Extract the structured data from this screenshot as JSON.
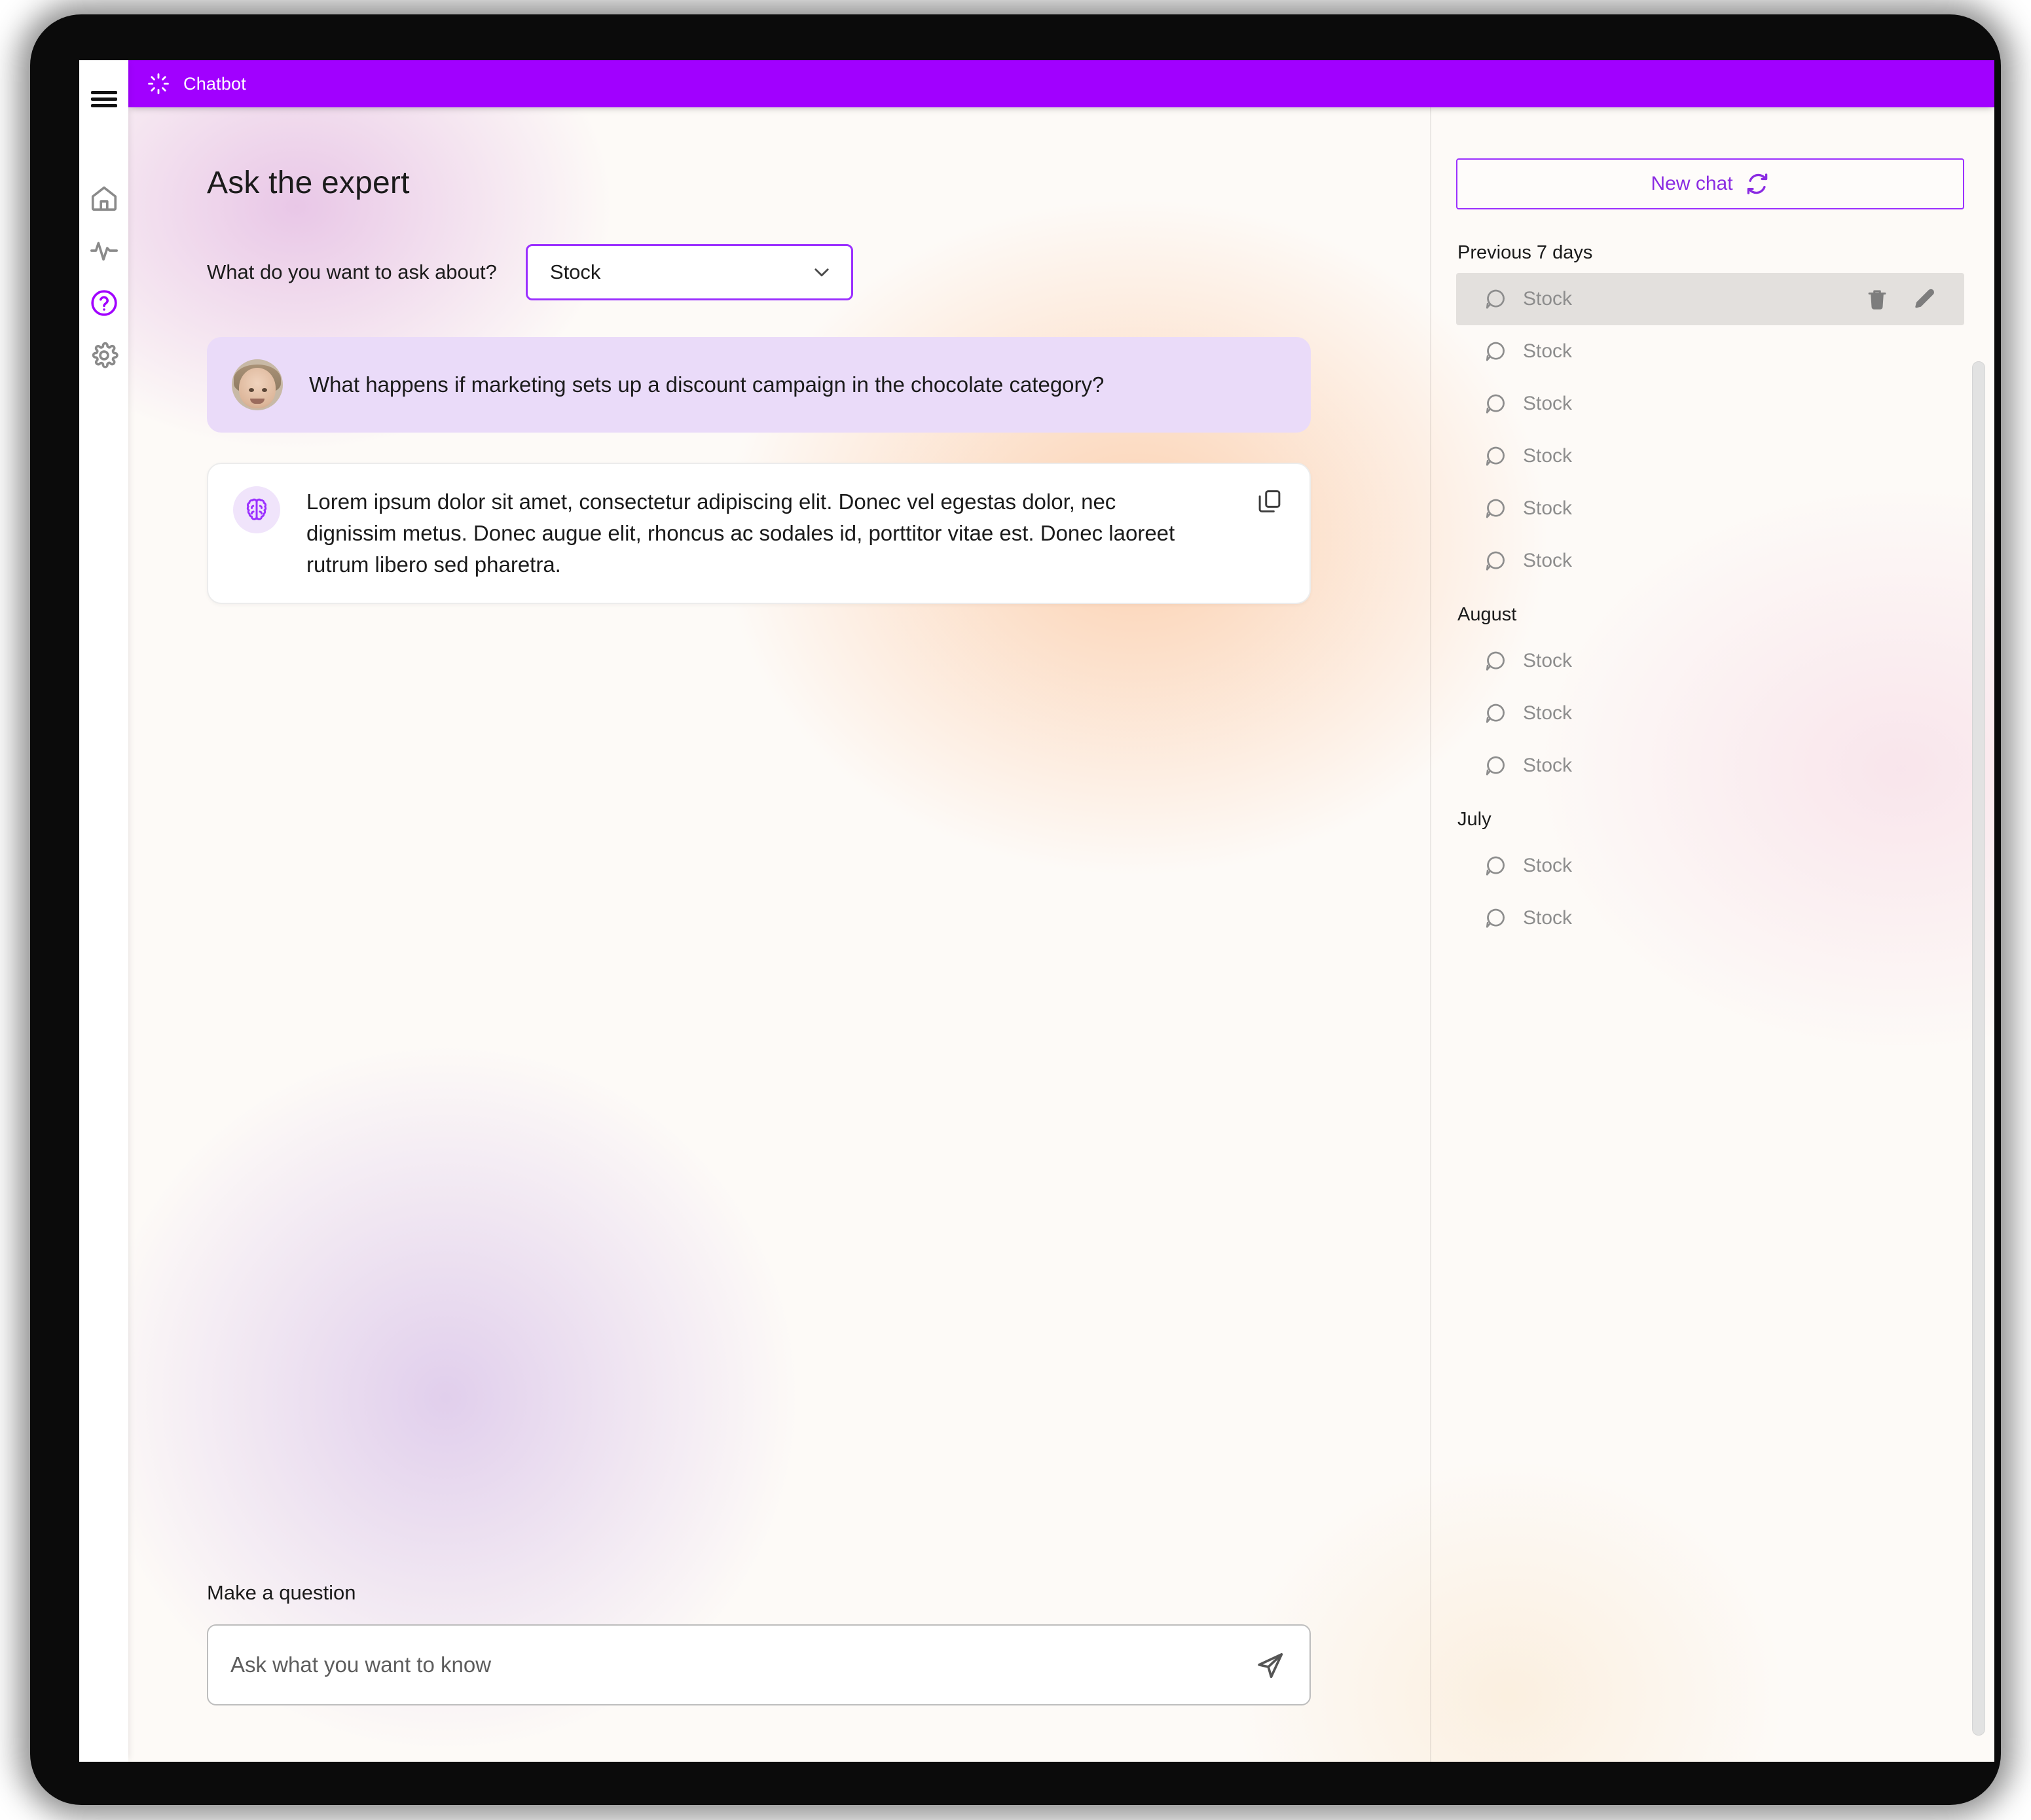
{
  "titlebar": {
    "logo_icon": "sparkle-icon",
    "title": "Chatbot",
    "bg_color": "#a100ff"
  },
  "sidebar": {
    "items": [
      {
        "icon": "hamburger-menu-icon",
        "name": "menu",
        "active": false
      },
      {
        "icon": "home-icon",
        "name": "home",
        "active": false
      },
      {
        "icon": "activity-pulse-icon",
        "name": "activity",
        "active": false
      },
      {
        "icon": "help-circle-icon",
        "name": "help",
        "active": true
      },
      {
        "icon": "settings-gear-icon",
        "name": "settings",
        "active": false
      }
    ],
    "active_color": "#a100ff",
    "inactive_color": "#8a8a8a"
  },
  "main": {
    "page_title": "Ask the expert",
    "topic_label": "What do you want to ask about?",
    "topic_select": {
      "value": "Stock",
      "chevron_icon": "chevron-down-icon",
      "border_color": "#9b30ff"
    },
    "messages": [
      {
        "role": "user",
        "avatar_icon": "user-avatar",
        "text": "What happens if marketing sets up a discount campaign in the chocolate category?"
      },
      {
        "role": "assistant",
        "avatar_icon": "brain-icon",
        "text": "Lorem ipsum dolor sit amet, consectetur adipiscing elit. Donec vel egestas dolor, nec dignissim metus. Donec augue elit, rhoncus ac sodales id, porttitor vitae est. Donec laoreet rutrum libero sed pharetra.",
        "copy_icon": "copy-icon"
      }
    ],
    "composer": {
      "label": "Make a question",
      "placeholder": "Ask what you want to know",
      "value": "",
      "send_icon": "send-paper-plane-icon"
    }
  },
  "history": {
    "new_chat": {
      "label": "New chat",
      "icon": "refresh-icon",
      "color": "#8a2be2"
    },
    "groups": [
      {
        "title": "Previous 7 days",
        "items": [
          {
            "label": "Stock",
            "icon": "chat-bubble-icon",
            "active": true,
            "actions": [
              {
                "icon": "trash-icon"
              },
              {
                "icon": "pencil-icon"
              }
            ]
          },
          {
            "label": "Stock",
            "icon": "chat-bubble-icon",
            "active": false
          },
          {
            "label": "Stock",
            "icon": "chat-bubble-icon",
            "active": false
          },
          {
            "label": "Stock",
            "icon": "chat-bubble-icon",
            "active": false
          },
          {
            "label": "Stock",
            "icon": "chat-bubble-icon",
            "active": false
          },
          {
            "label": "Stock",
            "icon": "chat-bubble-icon",
            "active": false
          }
        ]
      },
      {
        "title": "August",
        "items": [
          {
            "label": "Stock",
            "icon": "chat-bubble-icon",
            "active": false
          },
          {
            "label": "Stock",
            "icon": "chat-bubble-icon",
            "active": false
          },
          {
            "label": "Stock",
            "icon": "chat-bubble-icon",
            "active": false
          }
        ]
      },
      {
        "title": "July",
        "items": [
          {
            "label": "Stock",
            "icon": "chat-bubble-icon",
            "active": false
          },
          {
            "label": "Stock",
            "icon": "chat-bubble-icon",
            "active": false
          }
        ]
      }
    ]
  }
}
